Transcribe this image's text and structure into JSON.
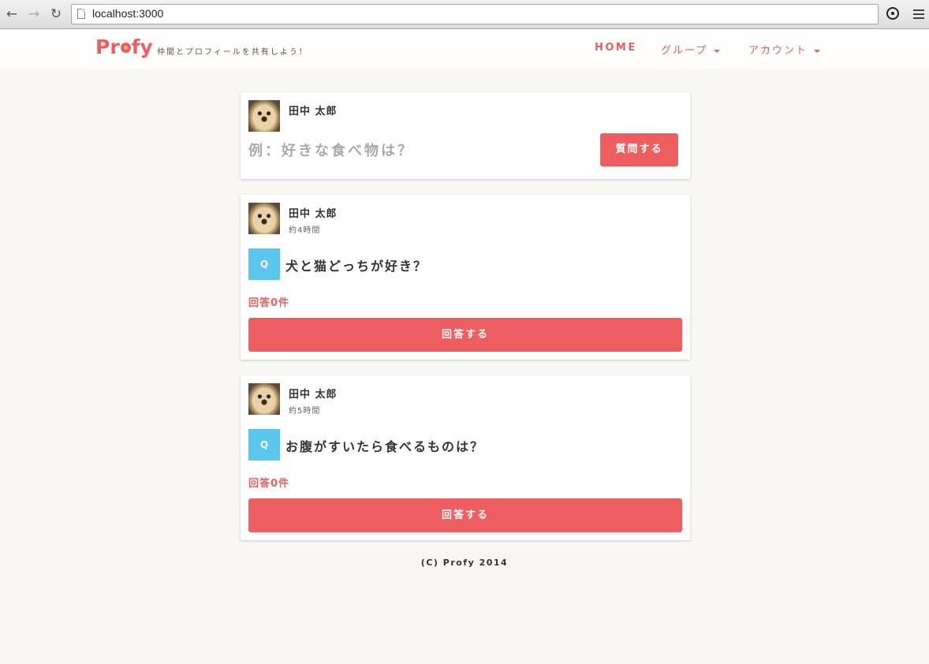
{
  "browser": {
    "url": "localhost:3000"
  },
  "header": {
    "logo": {
      "before": "Pr",
      "after": "fy"
    },
    "tagline": "仲間とプロフィールを共有しよう！",
    "nav": {
      "home": "HOME",
      "group": "グループ",
      "account": "アカウント"
    }
  },
  "ask_card": {
    "user_name": "田中 太郎",
    "placeholder": "例：好きな食べ物は？",
    "button": "質問する"
  },
  "questions": [
    {
      "user_name": "田中 太郎",
      "time": "約4時間",
      "badge": "Q",
      "text": "犬と猫どっちが好き？",
      "answer_count": "回答0件",
      "answer_button": "回答する"
    },
    {
      "user_name": "田中 太郎",
      "time": "約5時間",
      "badge": "Q",
      "text": "お腹がすいたら食べるものは？",
      "answer_count": "回答0件",
      "answer_button": "回答する"
    }
  ],
  "footer": {
    "text": "(C) Profy 2014"
  },
  "colors": {
    "accent": "#ee5e60",
    "q_badge": "#5bc7ef",
    "background": "#f9f7f3"
  }
}
